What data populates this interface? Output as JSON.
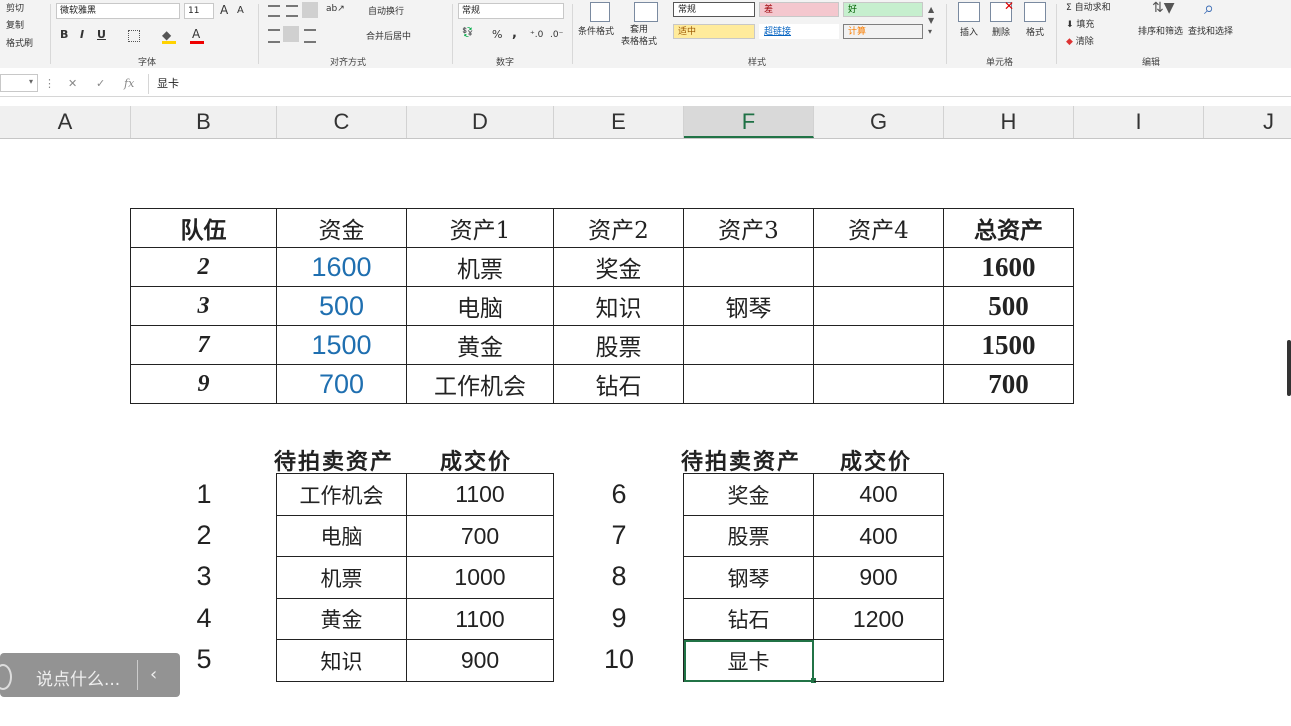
{
  "ribbon": {
    "clipboard": {
      "cut": "剪切",
      "copy": "复制",
      "format_painter": "格式刷"
    },
    "font": {
      "name": "微软雅黑",
      "size": "11",
      "group": "字体",
      "grow": "A",
      "shrink": "A",
      "bold": "B",
      "italic": "I",
      "underline": "U"
    },
    "alignment": {
      "wrap": "自动换行",
      "merge": "合并后居中",
      "group": "对齐方式"
    },
    "number": {
      "format": "常规",
      "percent": "%",
      "comma": ",",
      "group": "数字"
    },
    "styles": {
      "conditional": "条件格式",
      "table_format": "套用\n表格格式",
      "normal": "常规",
      "bad": "差",
      "good": "好",
      "neutral": "适中",
      "hyperlink": "超链接",
      "calc": "计算",
      "group": "样式",
      "colors": {
        "bad_bg": "#f4c7ce",
        "good_bg": "#c6efce",
        "neutral_bg": "#ffeb9c",
        "bad_fg": "#9c0006",
        "good_fg": "#006100",
        "neutral_fg": "#9c5700",
        "hyperlink_fg": "#0563c1",
        "calc_fg": "#fa7d00"
      }
    },
    "cells": {
      "insert": "插入",
      "delete": "删除",
      "format": "格式",
      "group": "单元格"
    },
    "editing": {
      "autosum": "自动求和",
      "fill": "填充",
      "clear": "清除",
      "sort_filter": "排序和筛选",
      "find_select": "查找和选择",
      "group": "编辑"
    }
  },
  "formula_bar": {
    "cancel": "✕",
    "enter": "✓",
    "fx": "fx",
    "content": "显卡"
  },
  "columns": [
    "A",
    "B",
    "C",
    "D",
    "E",
    "F",
    "G",
    "H",
    "I",
    "J"
  ],
  "selected_column": "F",
  "team_table": {
    "headers": [
      "队伍",
      "资金",
      "资产1",
      "资产2",
      "资产3",
      "资产4",
      "总资产"
    ],
    "rows": [
      {
        "team": "2",
        "funds": "1600",
        "a1": "机票",
        "a2": "奖金",
        "a3": "",
        "a4": "",
        "total": "1600"
      },
      {
        "team": "3",
        "funds": "500",
        "a1": "电脑",
        "a2": "知识",
        "a3": "钢琴",
        "a4": "",
        "total": "500"
      },
      {
        "team": "7",
        "funds": "1500",
        "a1": "黄金",
        "a2": "股票",
        "a3": "",
        "a4": "",
        "total": "1500"
      },
      {
        "team": "9",
        "funds": "700",
        "a1": "工作机会",
        "a2": "钻石",
        "a3": "",
        "a4": "",
        "total": "700"
      }
    ]
  },
  "auction_left": {
    "caption_asset": "待拍卖资产",
    "caption_price": "成交价",
    "rows": [
      {
        "no": "1",
        "asset": "工作机会",
        "price": "1100"
      },
      {
        "no": "2",
        "asset": "电脑",
        "price": "700"
      },
      {
        "no": "3",
        "asset": "机票",
        "price": "1000"
      },
      {
        "no": "4",
        "asset": "黄金",
        "price": "1100"
      },
      {
        "no": "5",
        "asset": "知识",
        "price": "900"
      }
    ]
  },
  "auction_right": {
    "caption_asset": "待拍卖资产",
    "caption_price": "成交价",
    "rows": [
      {
        "no": "6",
        "asset": "奖金",
        "price": "400"
      },
      {
        "no": "7",
        "asset": "股票",
        "price": "400"
      },
      {
        "no": "8",
        "asset": "钢琴",
        "price": "900"
      },
      {
        "no": "9",
        "asset": "钻石",
        "price": "1200"
      },
      {
        "no": "10",
        "asset": "显卡",
        "price": ""
      }
    ]
  },
  "chat": {
    "placeholder": "说点什么...",
    "arrow": "‹"
  }
}
